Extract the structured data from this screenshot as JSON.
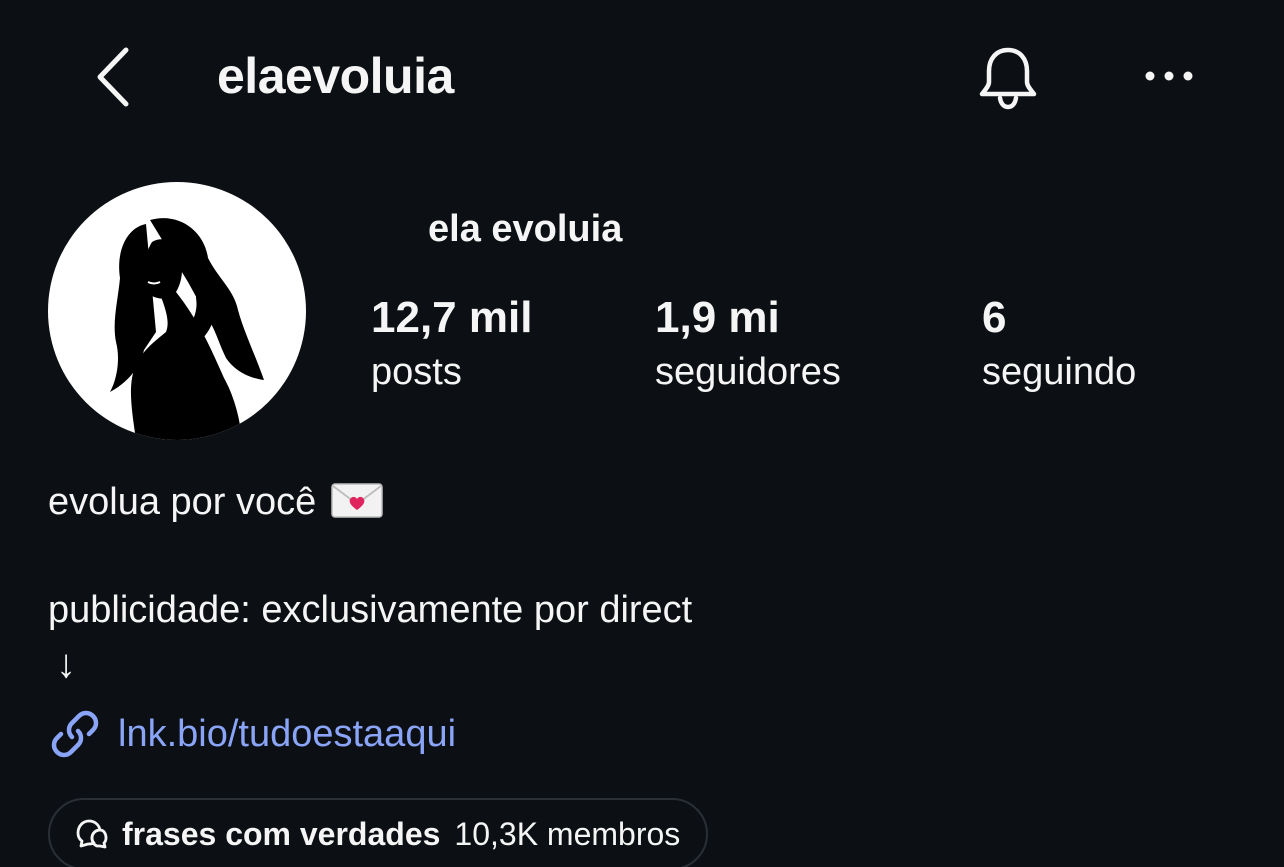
{
  "header": {
    "username": "elaevoluia",
    "icons": {
      "back": "chevron-left-icon",
      "notifications": "bell-icon",
      "more": "more-horizontal-icon"
    }
  },
  "profile": {
    "display_name": "ela evoluia",
    "avatar_icon": "woman-silhouette-avatar",
    "stats": {
      "posts": {
        "value": "12,7 mil",
        "label": "posts"
      },
      "followers": {
        "value": "1,9 mi",
        "label": "seguidores"
      },
      "following": {
        "value": "6",
        "label": "seguindo"
      }
    }
  },
  "bio": {
    "line1": "evolua por você",
    "line1_emoji": "love-letter-envelope",
    "line2": "publicidade: exclusivamente por direct",
    "arrow": "↓",
    "link": "lnk.bio/tudoestaaqui",
    "link_icon": "link-icon"
  },
  "channel": {
    "name": "frases com verdades",
    "members": "10,3K membros",
    "icon": "chat-bubbles-icon"
  },
  "colors": {
    "background": "#0c1014",
    "text": "#f5f5f5",
    "link": "#8aa4f8",
    "pill_border": "#2a2f35"
  }
}
